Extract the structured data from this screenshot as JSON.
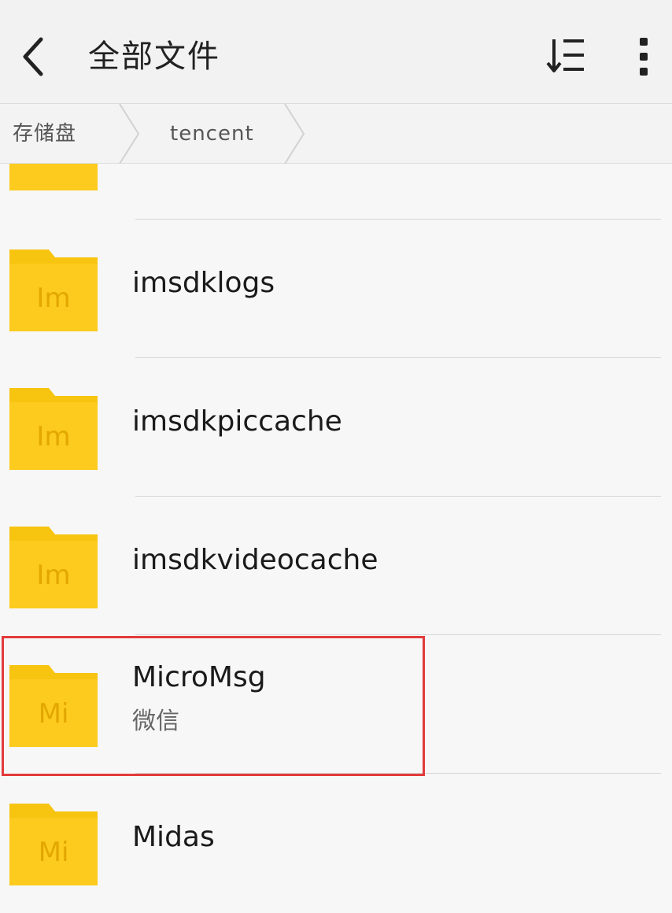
{
  "header": {
    "title": "全部文件"
  },
  "breadcrumb": {
    "root": "存储盘",
    "current": "tencent"
  },
  "folders": [
    {
      "abbr": "Im",
      "name": "imsdklogs"
    },
    {
      "abbr": "Im",
      "name": "imsdkpiccache"
    },
    {
      "abbr": "Im",
      "name": "imsdkvideocache"
    },
    {
      "abbr": "Mi",
      "name": "MicroMsg",
      "subtitle": "微信"
    },
    {
      "abbr": "Mi",
      "name": "Midas"
    }
  ],
  "colors": {
    "folder": "#fccb1e",
    "folder_tab": "#f7c410",
    "highlight": "#e23b3b"
  }
}
